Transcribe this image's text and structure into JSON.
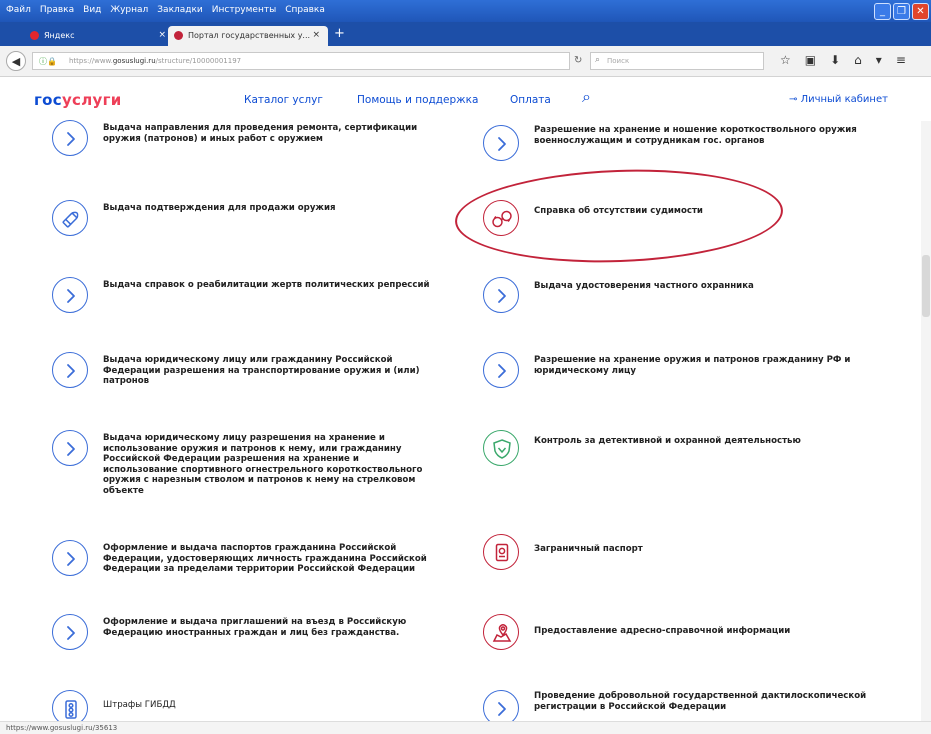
{
  "browser": {
    "menu_items": [
      "Файл",
      "Правка",
      "Вид",
      "Журнал",
      "Закладки",
      "Инструменты",
      "Справка"
    ],
    "tabs": [
      {
        "label": "Яндекс"
      },
      {
        "label": "Портал государственных у..."
      }
    ],
    "url_prefix": "https://www.",
    "url_domain": "gosuslugi.ru",
    "url_path": "/structure/10000001197",
    "search_placeholder": "Поиск",
    "status_url": "https://www.gosuslugi.ru/35613"
  },
  "header": {
    "logo_blue": "гос",
    "logo_red": "услуги",
    "nav": {
      "catalog": "Каталог услуг",
      "help": "Помощь и поддержка",
      "payment": "Оплата"
    },
    "cabinet": "Личный кабинет"
  },
  "services": {
    "left": [
      {
        "title": "Выдача направления для проведения ремонта, сертификации оружия (патронов) и иных работ с оружием"
      },
      {
        "title": "Выдача подтверждения для продажи оружия"
      },
      {
        "title": "Выдача справок о реабилитации жертв политических репрессий"
      },
      {
        "title": "Выдача юридическому лицу или гражданину Российской Федерации разрешения на транспортирование оружия и (или) патронов"
      },
      {
        "title": "Выдача юридическому лицу разрешения на хранение и использование оружия и патронов к нему, или гражданину Российской Федерации разрешения на хранение и использование спортивного огнестрельного короткоствольного оружия с нарезным стволом и патронов к нему на стрелковом объекте"
      },
      {
        "title": "Оформление и выдача паспортов гражданина Российской Федерации, удостоверяющих личность гражданина Российской Федерации за пределами территории Российской Федерации"
      },
      {
        "title": "Оформление и выдача приглашений на въезд в Российскую Федерацию иностранных граждан и лиц без гражданства."
      },
      {
        "title": "Штрафы ГИБДД"
      }
    ],
    "right": [
      {
        "title": "Разрешение на хранение и ношение короткоствольного оружия военнослужащим и сотрудникам гос. органов"
      },
      {
        "title": "Справка об отсутствии судимости"
      },
      {
        "title": "Выдача удостоверения частного охранника"
      },
      {
        "title": "Разрешение на хранение оружия и патронов гражданину РФ и юридическому лицу"
      },
      {
        "title": "Контроль за детективной и охранной деятельностью"
      },
      {
        "title": "Заграничный паспорт"
      },
      {
        "title": "Предоставление адресно-справочной информации"
      },
      {
        "title": "Проведение добровольной государственной дактилоскопической регистрации в Российской Федерации"
      }
    ]
  },
  "colors": {
    "brand_blue": "#0d4cd3",
    "brand_red": "#ee3f58",
    "icon_blue": "#3b6dd8",
    "icon_red": "#c2233a",
    "icon_green": "#3aa86b",
    "highlight": "#c2233a"
  }
}
